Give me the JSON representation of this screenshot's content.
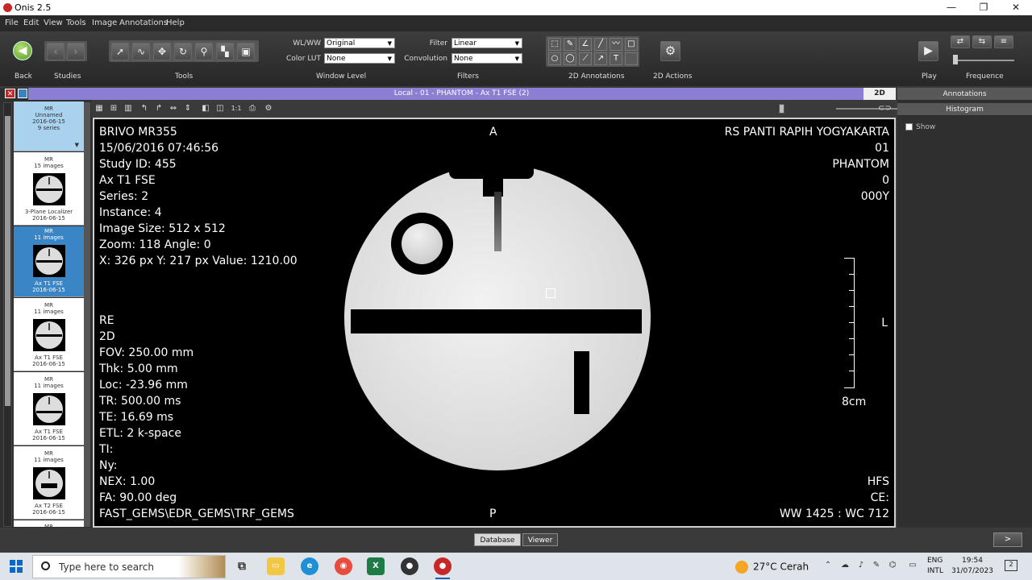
{
  "window": {
    "title": "Onis 2.5",
    "minimize": "—",
    "maximize": "❐",
    "close": "✕"
  },
  "menu": [
    "File",
    "Edit",
    "View",
    "Tools",
    "Image",
    "Annotations",
    "Help"
  ],
  "toolbar": {
    "back_label": "Back",
    "studies_label": "Studies",
    "tools_label": "Tools",
    "window_level_label": "Window Level",
    "filters_label": "Filters",
    "annotations_label": "2D Annotations",
    "actions_label": "2D Actions",
    "play_label": "Play",
    "frequence_label": "Frequence",
    "wlww_label": "WL/WW",
    "wlww_value": "Original",
    "colorlut_label": "Color LUT",
    "colorlut_value": "None",
    "filter_label": "Filter",
    "filter_value": "Linear",
    "convolution_label": "Convolution",
    "convolution_value": "None"
  },
  "tab": {
    "title": "Local - 01 - PHANTOM - Ax T1 FSE (2)",
    "mode": "2D"
  },
  "study": {
    "modality": "MR",
    "name": "Unnamed",
    "date": "2016-06-15",
    "series": "9 series"
  },
  "thumbnails": [
    {
      "modality": "MR",
      "count": "15 images",
      "name": "3-Plane Localizer",
      "date": "2016-06-15",
      "selected": false
    },
    {
      "modality": "MR",
      "count": "11 images",
      "name": "Ax T1 FSE",
      "date": "2016-06-15",
      "selected": true
    },
    {
      "modality": "MR",
      "count": "11 images",
      "name": "Ax T1 FSE",
      "date": "2016-06-15",
      "selected": false
    },
    {
      "modality": "MR",
      "count": "11 images",
      "name": "Ax T1 FSE",
      "date": "2016-06-15",
      "selected": false
    },
    {
      "modality": "MR",
      "count": "11 images",
      "name": "Ax T2 FSE",
      "date": "2016-06-15",
      "selected": false
    },
    {
      "modality": "MR",
      "count": "",
      "name": "",
      "date": "",
      "selected": false
    }
  ],
  "overlay": {
    "top_left": [
      "BRIVO MR355",
      "15/06/2016 07:46:56",
      "Study ID: 455",
      "Ax T1 FSE",
      "Series: 2",
      "Instance: 4",
      "Image Size: 512 x 512",
      "Zoom: 118 Angle: 0",
      "X: 326 px Y: 217 px Value: 1210.00"
    ],
    "bottom_left": [
      "RE",
      "2D",
      "FOV: 250.00 mm",
      "Thk: 5.00 mm",
      "Loc: -23.96 mm",
      "TR: 500.00 ms",
      "TE: 16.69 ms",
      "ETL: 2 k-space",
      "TI:",
      "Ny:",
      "NEX: 1.00",
      "FA: 90.00 deg",
      "FAST_GEMS\\EDR_GEMS\\TRF_GEMS"
    ],
    "top_right": [
      "RS PANTI RAPIH YOGYAKARTA",
      "01",
      "PHANTOM",
      "0",
      "000Y"
    ],
    "bottom_right": [
      "HFS",
      "CE:",
      "WW 1425 : WC 712"
    ],
    "top": "A",
    "bottom": "P",
    "right": "L",
    "scale": "8cm"
  },
  "right_panel": {
    "annotations": "Annotations",
    "histogram": "Histogram",
    "show": "Show"
  },
  "statusbar": {
    "database": "Database",
    "viewer": "Viewer",
    "next": ">"
  },
  "taskbar": {
    "search_placeholder": "Type here to search",
    "weather": "27°C  Cerah",
    "lang1": "ENG",
    "lang2": "INTL",
    "time": "19:54",
    "date": "31/07/2023",
    "notifications": "2"
  }
}
